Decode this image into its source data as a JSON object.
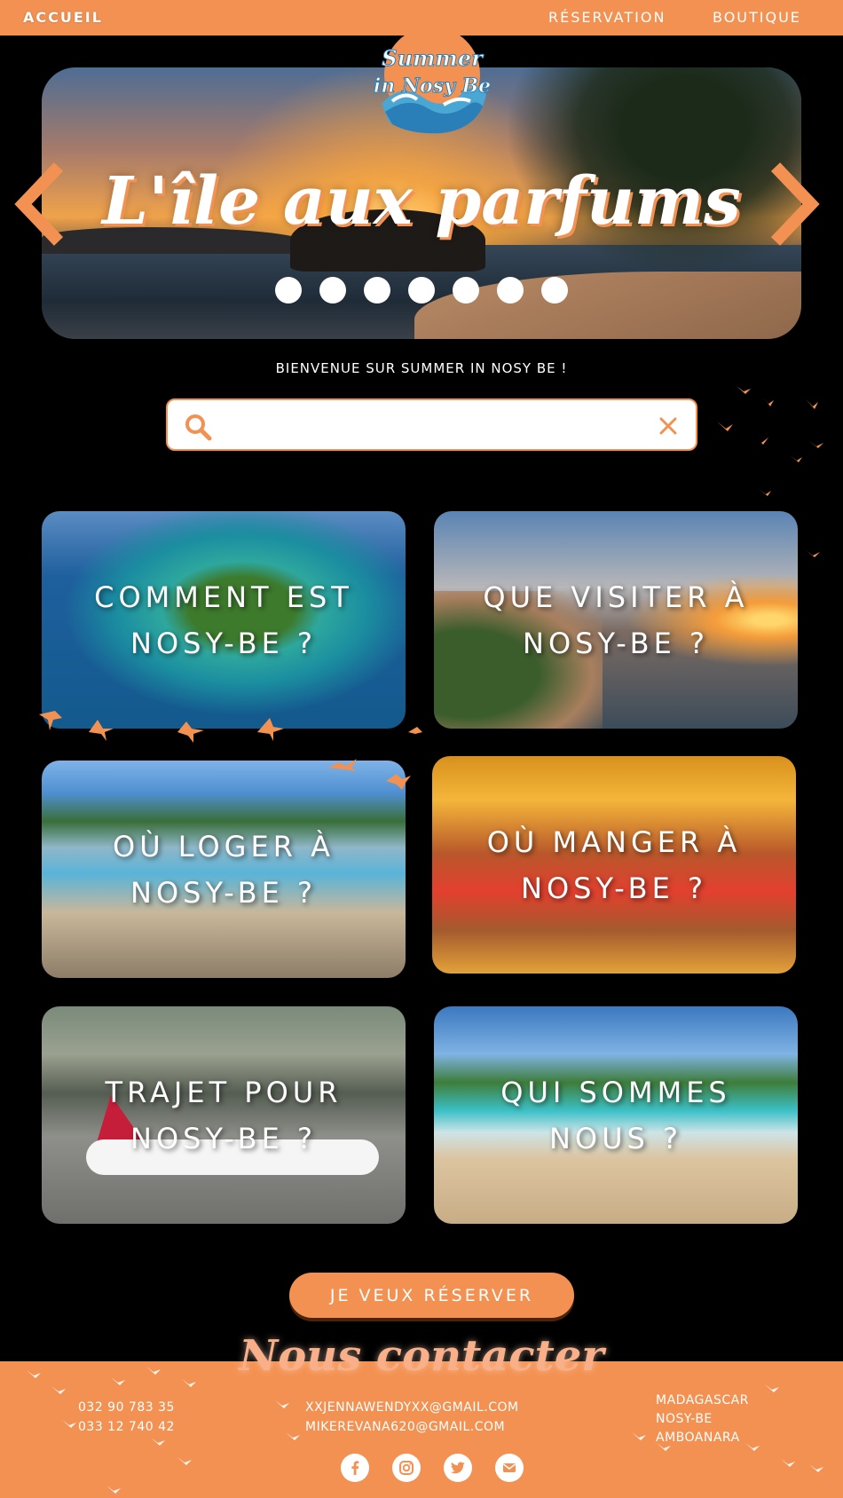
{
  "nav": {
    "home": "ACCUEIL",
    "reservation": "RÉSERVATION",
    "shop": "BOUTIQUE"
  },
  "logo": {
    "line1": "Summer",
    "line2": "in Nosy Be"
  },
  "hero": {
    "title": "L'île aux parfums",
    "slide_count": 7
  },
  "welcome": "BIENVENUE SUR SUMMER IN NOSY BE !",
  "search": {
    "value": "",
    "placeholder": ""
  },
  "cards": [
    {
      "label": "COMMENT EST NOSY-BE ?"
    },
    {
      "label": "QUE VISITER À NOSY-BE ?"
    },
    {
      "label": "OÙ LOGER À NOSY-BE ?"
    },
    {
      "label": "OÙ MANGER À NOSY-BE ?"
    },
    {
      "label": "TRAJET POUR NOSY-BE ?"
    },
    {
      "label": "QUI SOMMES NOUS ?"
    }
  ],
  "cta": "JE VEUX RÉSERVER",
  "footer": {
    "title": "Nous contacter",
    "phones": [
      "032 90 783 35",
      "033 12 740 42"
    ],
    "emails": [
      "XXJENNAWENDYXX@GMAIL.COM",
      "MIKEREVANA620@GMAIL.COM"
    ],
    "address": [
      "MADAGASCAR",
      "NOSY-BE",
      "AMBOANARA"
    ],
    "socials": [
      "facebook-icon",
      "instagram-icon",
      "twitter-icon",
      "mail-icon"
    ]
  },
  "colors": {
    "accent": "#F39152",
    "background": "#000000"
  }
}
